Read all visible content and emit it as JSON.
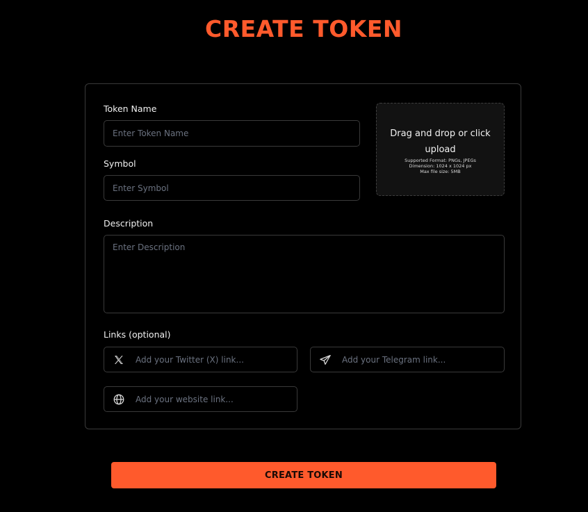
{
  "header": {
    "title": "CREATE TOKEN"
  },
  "form": {
    "token_name": {
      "label": "Token Name",
      "placeholder": "Enter Token Name"
    },
    "symbol": {
      "label": "Symbol",
      "placeholder": "Enter Symbol"
    },
    "description": {
      "label": "Description",
      "placeholder": "Enter Description"
    },
    "upload": {
      "title": "Drag and drop or click upload",
      "formats": "Supported Format: PNGs, JPEGs",
      "dimension": "Dimension: 1024 x 1024 px",
      "max_size": "Max file size: 5MB"
    },
    "links": {
      "label": "Links (optional)",
      "twitter": {
        "placeholder": "Add your Twitter (X) link...",
        "icon": "x-twitter-icon"
      },
      "telegram": {
        "placeholder": "Add your Telegram link...",
        "icon": "telegram-icon"
      },
      "website": {
        "placeholder": "Add your website link...",
        "icon": "globe-icon"
      }
    }
  },
  "submit": {
    "label": "CREATE TOKEN"
  },
  "colors": {
    "accent": "#ff5a2c",
    "background": "#000000",
    "border": "#3a3a3a",
    "placeholder": "#6b7280",
    "upload_bg": "#121212"
  }
}
